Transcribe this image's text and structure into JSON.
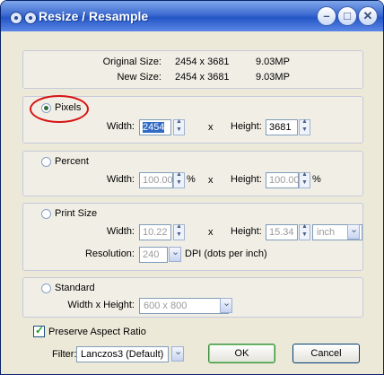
{
  "window": {
    "title": "Resize / Resample"
  },
  "info": {
    "original_label": "Original Size:",
    "original_dims": "2454 x 3681",
    "original_mp": "9.03MP",
    "new_label": "New Size:",
    "new_dims": "2454 x 3681",
    "new_mp": "9.03MP"
  },
  "pixels": {
    "label": "Pixels",
    "width_label": "Width:",
    "width": "2454",
    "x": "x",
    "height_label": "Height:",
    "height": "3681"
  },
  "percent": {
    "label": "Percent",
    "width_label": "Width:",
    "width": "100.00",
    "unit": "%",
    "x": "x",
    "height_label": "Height:",
    "height": "100.00",
    "unit2": "%"
  },
  "print": {
    "label": "Print Size",
    "width_label": "Width:",
    "width": "10.22",
    "x": "x",
    "height_label": "Height:",
    "height": "15.34",
    "unit": "inch",
    "res_label": "Resolution:",
    "res": "240",
    "dpi_label": "DPI (dots per inch)"
  },
  "standard": {
    "label": "Standard",
    "wh_label": "Width x Height:",
    "value": "600 x 800"
  },
  "preserve": {
    "label": "Preserve Aspect Ratio",
    "checked": true
  },
  "filter": {
    "label": "Filter:",
    "value": "Lanczos3 (Default)"
  },
  "buttons": {
    "ok": "OK",
    "cancel": "Cancel"
  }
}
